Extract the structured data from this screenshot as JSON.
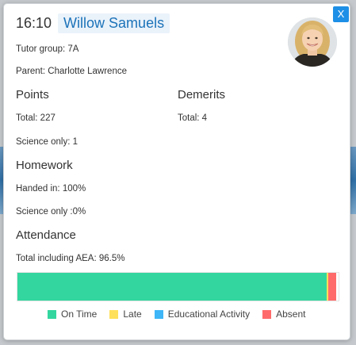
{
  "header": {
    "time": "16:10",
    "student_name": "Willow Samuels",
    "close_label": "X"
  },
  "info": {
    "tutor_group": "Tutor group: 7A",
    "parent": "Parent: Charlotte Lawrence"
  },
  "points": {
    "heading": "Points",
    "total": "Total: 227",
    "science": "Science only: 1"
  },
  "demerits": {
    "heading": "Demerits",
    "total": "Total: 4"
  },
  "homework": {
    "heading": "Homework",
    "handed_in": "Handed in: 100%",
    "science": "Science only :0%"
  },
  "attendance": {
    "heading": "Attendance",
    "total": "Total including AEA: 96.5%",
    "segments": [
      {
        "name": "On Time",
        "fraction": 0.963,
        "color": "#33d69f"
      },
      {
        "name": "Late",
        "fraction": 0.005,
        "color": "#ffe05a"
      },
      {
        "name": "Educational Activity",
        "fraction": 0.0,
        "color": "#3fb6f7"
      },
      {
        "name": "Absent",
        "fraction": 0.025,
        "color": "#ff6b6b"
      }
    ],
    "legend": [
      {
        "label": "On Time",
        "color": "#33d69f"
      },
      {
        "label": "Late",
        "color": "#ffe05a"
      },
      {
        "label": "Educational Activity",
        "color": "#3fb6f7"
      },
      {
        "label": "Absent",
        "color": "#ff6b6b"
      }
    ]
  },
  "colors": {
    "accent": "#1e8fe6",
    "name_text": "#1c73b9"
  }
}
